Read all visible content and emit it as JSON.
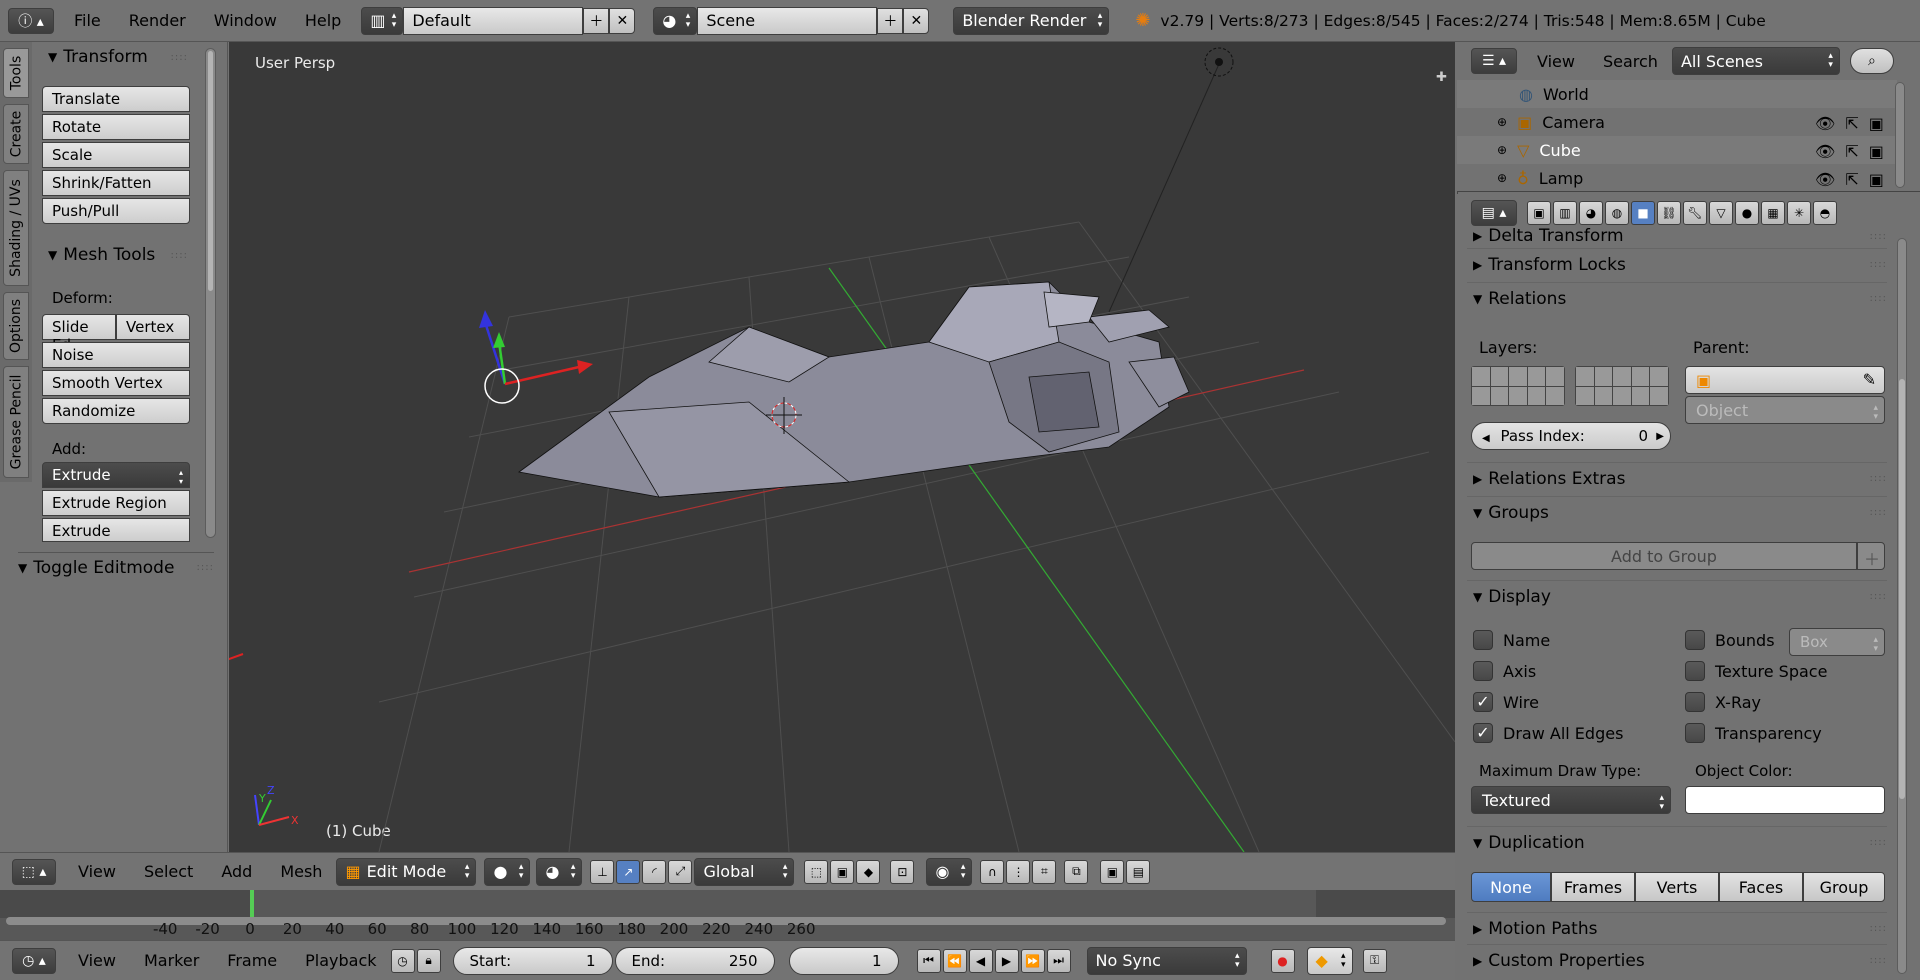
{
  "topbar": {
    "menus": [
      "File",
      "Render",
      "Window",
      "Help"
    ],
    "layout": "Default",
    "scene": "Scene",
    "engine": "Blender Render",
    "stats": "v2.79 | Verts:8/273 | Edges:8/545 | Faces:2/274 | Tris:548 | Mem:8.65M | Cube"
  },
  "toolshelf": {
    "tabs": [
      "Tools",
      "Create",
      "Shading / UVs",
      "Options",
      "Grease Pencil"
    ],
    "transform_title": "Transform",
    "transform_buttons": [
      "Translate",
      "Rotate",
      "Scale",
      "Shrink/Fatten",
      "Push/Pull"
    ],
    "mesh_tools_title": "Mesh Tools",
    "deform_label": "Deform:",
    "slide_edge": "Slide Ed",
    "vertex": "Vertex",
    "deform_buttons": [
      "Noise",
      "Smooth Vertex",
      "Randomize"
    ],
    "add_label": "Add:",
    "extrude": "Extrude",
    "add_buttons": [
      "Extrude Region",
      "Extrude Individual"
    ],
    "toggle_editmode": "Toggle Editmode"
  },
  "viewport": {
    "view_name": "User Persp",
    "object_label": "(1) Cube",
    "axis_x": "X",
    "axis_y": "Y",
    "axis_z": "Z"
  },
  "viewport_header": {
    "menus": [
      "View",
      "Select",
      "Add",
      "Mesh"
    ],
    "mode": "Edit Mode",
    "orientation": "Global"
  },
  "timeline": {
    "ticks": [
      "-40",
      "-20",
      "0",
      "20",
      "40",
      "60",
      "80",
      "100",
      "120",
      "140",
      "160",
      "180",
      "200",
      "220",
      "240",
      "260"
    ],
    "tick_values": [
      -40,
      -20,
      0,
      20,
      40,
      60,
      80,
      100,
      120,
      140,
      160,
      180,
      200,
      220,
      240,
      260
    ],
    "current_frame_marker": 1,
    "menus": [
      "View",
      "Marker",
      "Frame",
      "Playback"
    ],
    "start_label": "Start:",
    "start_value": "1",
    "end_label": "End:",
    "end_value": "250",
    "current_value": "1",
    "sync": "No Sync"
  },
  "outliner": {
    "menus": [
      "View",
      "Search"
    ],
    "filter": "All Scenes",
    "items": [
      "World",
      "Camera",
      "Cube",
      "Lamp"
    ]
  },
  "properties": {
    "sections": {
      "delta": "Delta Transform",
      "locks": "Transform Locks",
      "relations": "Relations",
      "relations_extras": "Relations Extras",
      "groups": "Groups",
      "display": "Display",
      "duplication": "Duplication",
      "motion": "Motion Paths",
      "custom": "Custom Properties"
    },
    "layers_label": "Layers:",
    "parent_label": "Parent:",
    "parent_type": "Object",
    "pass_index_label": "Pass Index:",
    "pass_index_value": "0",
    "add_to_group": "Add to Group",
    "display": {
      "name": "Name",
      "axis": "Axis",
      "wire": "Wire",
      "draw_all_edges": "Draw All Edges",
      "bounds": "Bounds",
      "bounds_type": "Box",
      "texture_space": "Texture Space",
      "xray": "X-Ray",
      "transparency": "Transparency",
      "max_draw_label": "Maximum Draw Type:",
      "max_draw_value": "Textured",
      "object_color_label": "Object Color:"
    },
    "duplication": [
      "None",
      "Frames",
      "Verts",
      "Faces",
      "Group"
    ],
    "duplication_selected": "None"
  }
}
